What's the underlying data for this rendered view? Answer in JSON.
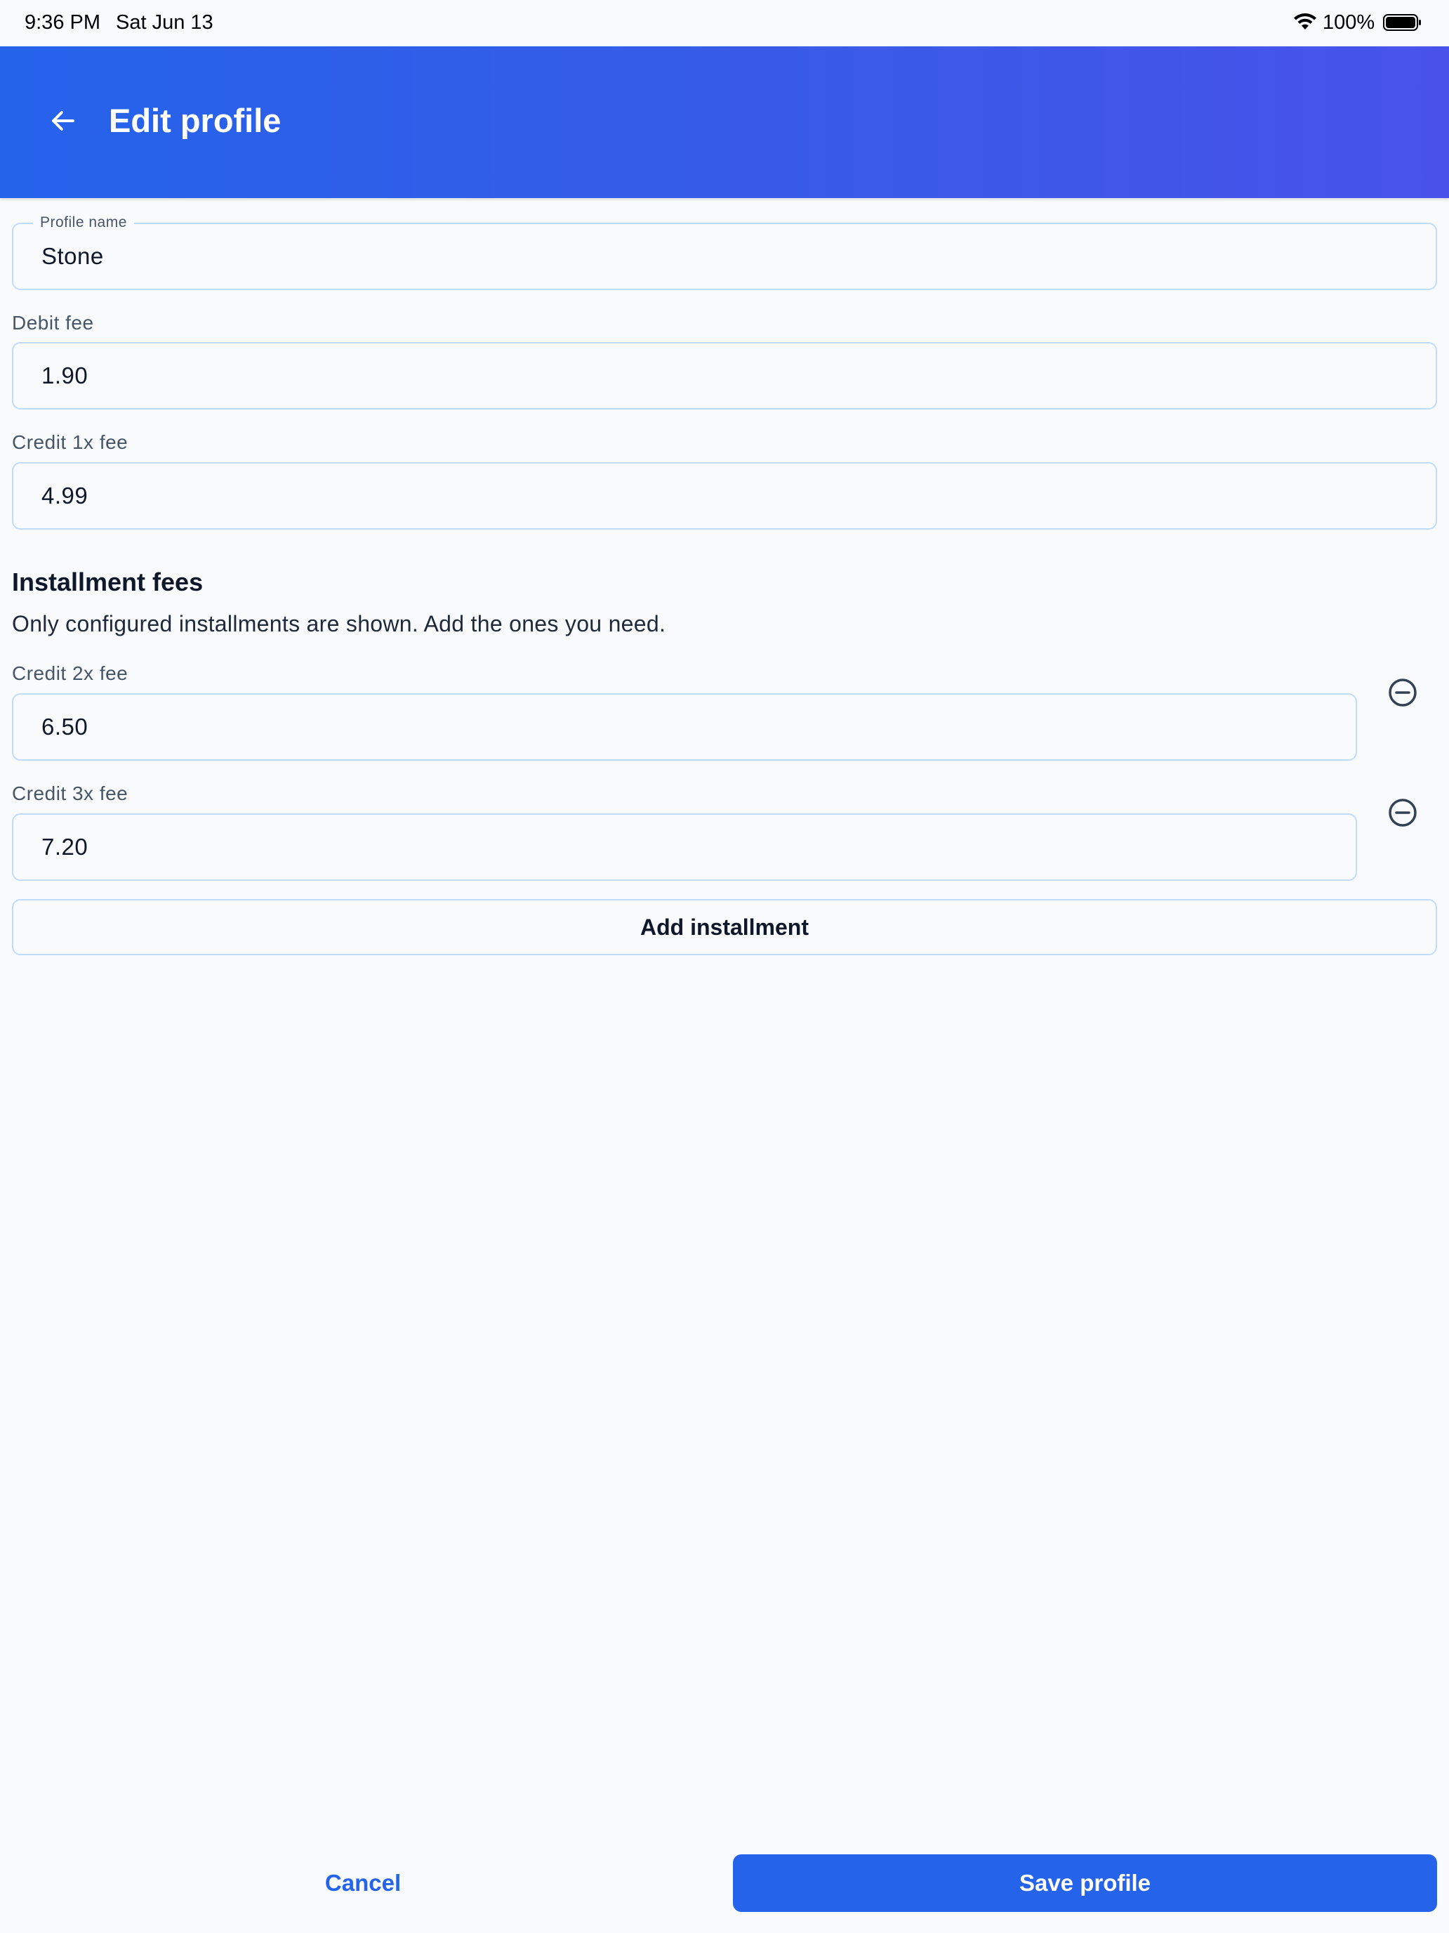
{
  "status_bar": {
    "time": "9:36 PM",
    "date": "Sat Jun 13",
    "battery": "100%"
  },
  "header": {
    "title": "Edit profile",
    "back_icon": "arrow-left-icon",
    "background_colors": [
      "#2563eb",
      "#4953ec"
    ]
  },
  "form": {
    "profile_name": {
      "label": "Profile name",
      "value": "Stone"
    },
    "debit_fee": {
      "label": "Debit fee",
      "value": "1.90"
    },
    "credit_1x_fee": {
      "label": "Credit 1x fee",
      "value": "4.99"
    }
  },
  "installments": {
    "title": "Installment fees",
    "subtitle": "Only configured installments are shown. Add the ones you need.",
    "items": [
      {
        "label": "Credit 2x fee",
        "value": "6.50",
        "remove_icon": "minus-circle-icon"
      },
      {
        "label": "Credit 3x fee",
        "value": "7.20",
        "remove_icon": "minus-circle-icon"
      }
    ],
    "add_label": "Add installment"
  },
  "footer": {
    "cancel_label": "Cancel",
    "save_label": "Save profile"
  },
  "colors": {
    "accent": "#2563eb",
    "field_border": "#bfdbfe",
    "background": "#f8fafc"
  }
}
